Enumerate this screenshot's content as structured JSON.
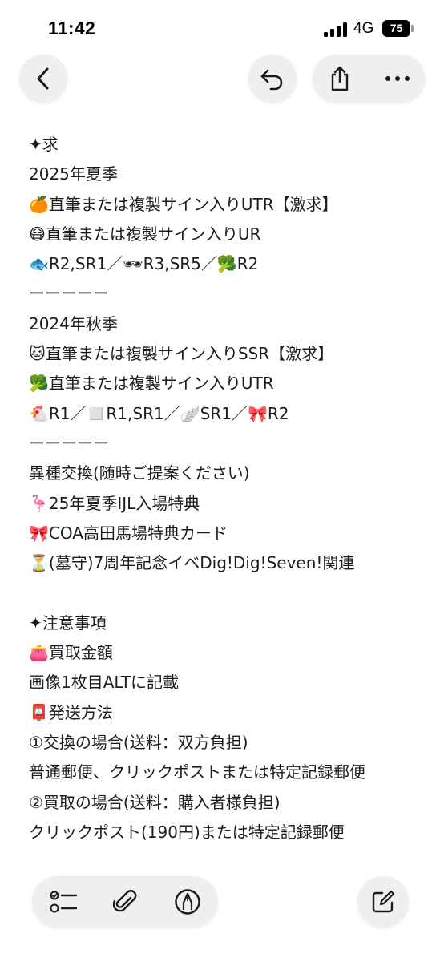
{
  "status_bar": {
    "time": "11:42",
    "network": "4G",
    "battery": "75"
  },
  "icons": {
    "back": "chevron-left-icon",
    "undo": "undo-icon",
    "share": "share-icon",
    "more": "ellipsis-icon",
    "checklist": "checklist-icon",
    "attach": "paperclip-icon",
    "markup": "pen-markup-icon",
    "compose": "compose-icon"
  },
  "note": {
    "lines": [
      "✦求",
      "2025年夏季",
      "🍊直筆または複製サイン入りUTR【激求】",
      "😷直筆または複製サイン入りUR",
      "🐟R2,SR1／🕶R3,SR5／🥦R2",
      "ーーーーー",
      "2024年秋季",
      "🐱直筆または複製サイン入りSSR【激求】",
      "🥦直筆または複製サイン入りUTR",
      "🐔R1／◻️R1,SR1／🪽SR1／🎀R2",
      "ーーーーー",
      "異種交換(随時ご提案ください)",
      "🦩25年夏季IJL入場特典",
      "🎀COA高田馬場特典カード",
      "⏳(墓守)7周年記念イベDig!Dig!Seven!関連",
      "",
      "✦注意事項",
      "👛買取金額",
      "画像1枚目ALTに記載",
      "📮発送方法",
      "①交換の場合(送料：双方負担)",
      "普通郵便、クリックポストまたは特定記録郵便",
      "②買取の場合(送料：購入者様負担)",
      "クリックポスト(190円)または特定記録郵便"
    ]
  }
}
